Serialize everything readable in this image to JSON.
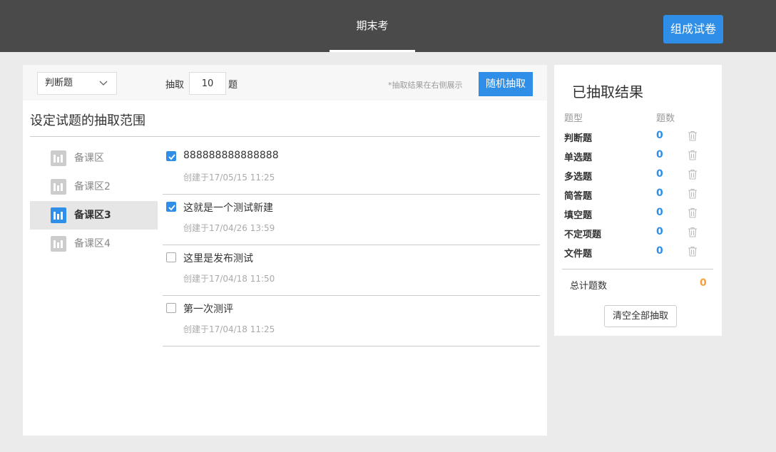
{
  "header": {
    "tab_title": "期末考",
    "compose_button": "组成试卷"
  },
  "toolbar": {
    "type_select_value": "判断题",
    "pick_label": "抽取",
    "pick_count": "10",
    "pick_unit": "题",
    "hint": "*抽取结果在右侧展示",
    "random_button": "随机抽取"
  },
  "section": {
    "title": "设定试题的抽取范围"
  },
  "sidebar": {
    "items": [
      {
        "label": "备课区",
        "active": false,
        "icon": "bank-icon"
      },
      {
        "label": "备课区2",
        "active": false,
        "icon": "bank-icon"
      },
      {
        "label": "备课区3",
        "active": true,
        "icon": "bank-icon"
      },
      {
        "label": "备课区4",
        "active": false,
        "icon": "bank-icon"
      }
    ]
  },
  "questions": [
    {
      "title": "888888888888888",
      "date": "创建于17/05/15 11:25",
      "checked": true
    },
    {
      "title": "这就是一个测试新建",
      "date": "创建于17/04/26 13:59",
      "checked": true
    },
    {
      "title": "这里是发布测试",
      "date": "创建于17/04/18 11:50",
      "checked": false
    },
    {
      "title": "第一次测评",
      "date": "创建于17/04/18 11:25",
      "checked": false
    }
  ],
  "results": {
    "title": "已抽取结果",
    "col_type": "题型",
    "col_count": "题数",
    "rows": [
      {
        "type": "判断题",
        "count": "0"
      },
      {
        "type": "单选题",
        "count": "0"
      },
      {
        "type": "多选题",
        "count": "0"
      },
      {
        "type": "简答题",
        "count": "0"
      },
      {
        "type": "填空题",
        "count": "0"
      },
      {
        "type": "不定项题",
        "count": "0"
      },
      {
        "type": "文件题",
        "count": "0"
      }
    ],
    "total_label": "总计题数",
    "total_value": "0",
    "clear_button": "清空全部抽取"
  },
  "colors": {
    "accent": "#2f8fe8",
    "header_bg": "#4a4a4a",
    "total_color": "#f5a23c"
  }
}
